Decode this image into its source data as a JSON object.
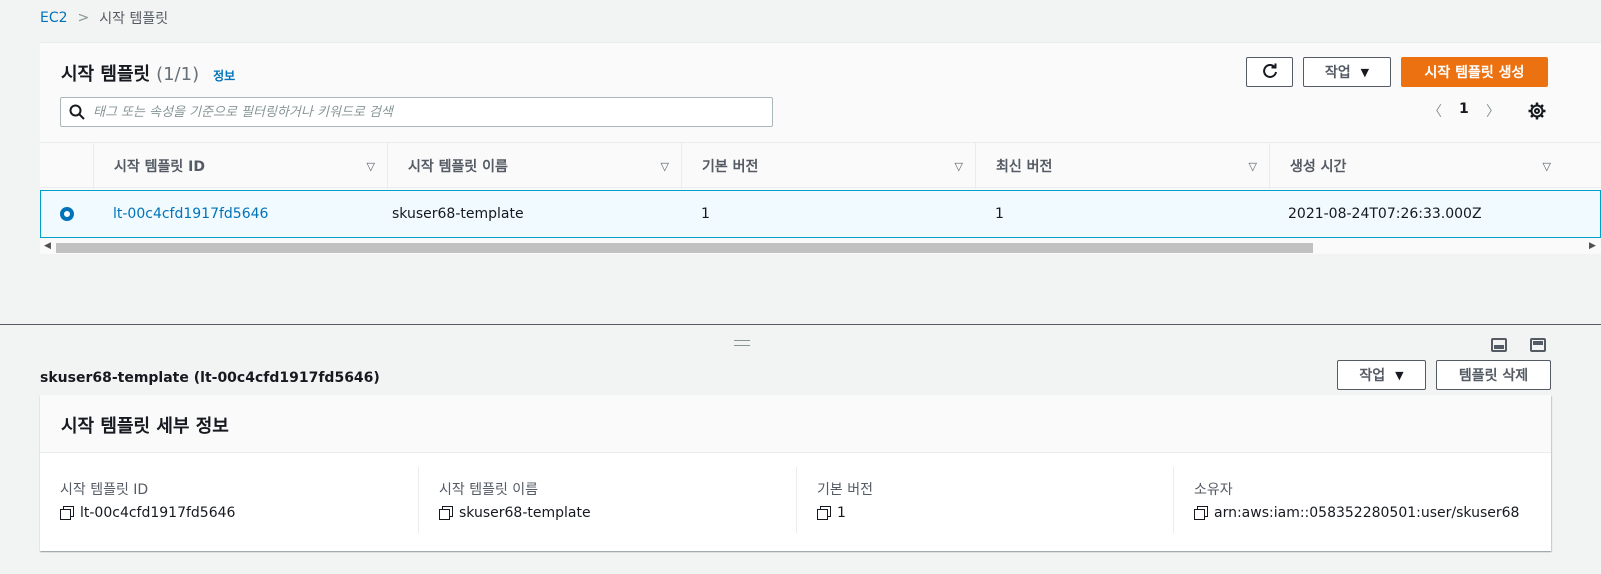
{
  "breadcrumb": {
    "root": "EC2",
    "separator": ">",
    "current": "시작 템플릿"
  },
  "list_panel": {
    "title": "시작 템플릿",
    "count": "(1/1)",
    "info_link": "정보",
    "refresh_icon": "refresh-icon",
    "actions_label": "작업",
    "create_label": "시작 템플릿 생성",
    "search_placeholder": "태그 또는 속성을 기준으로 필터링하거나 키워드로 검색",
    "page_number": "1",
    "prev_glyph": "〈",
    "next_glyph": "〉",
    "settings_icon": "gear-icon"
  },
  "table": {
    "columns": [
      "시작 템플릿 ID",
      "시작 템플릿 이름",
      "기본 버전",
      "최신 버전",
      "생성 시간"
    ],
    "rows": [
      {
        "id": "lt-00c4cfd1917fd5646",
        "name": "skuser68-template",
        "default_version": "1",
        "latest_version": "1",
        "created": "2021-08-24T07:26:33.000Z"
      }
    ]
  },
  "detail": {
    "title": "skuser68-template (lt-00c4cfd1917fd5646)",
    "actions_label": "작업",
    "delete_label": "템플릿 삭제",
    "section_title": "시작 템플릿 세부 정보",
    "fields": [
      {
        "label": "시작 템플릿 ID",
        "value": "lt-00c4cfd1917fd5646"
      },
      {
        "label": "시작 템플릿 이름",
        "value": "skuser68-template"
      },
      {
        "label": "기본 버전",
        "value": "1"
      },
      {
        "label": "소유자",
        "value": "arn:aws:iam::058352280501:user/skuser68"
      }
    ]
  },
  "colors": {
    "primary": "#ec7211",
    "link": "#0073bb",
    "selected_row": "#f1faff",
    "selected_border": "#00a1c9"
  }
}
